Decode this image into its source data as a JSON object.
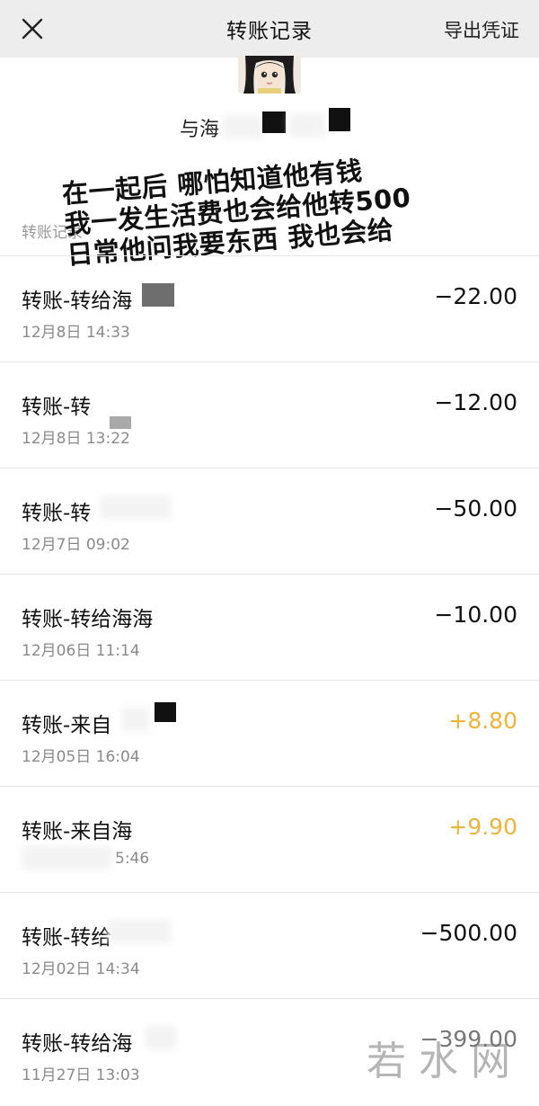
{
  "header": {
    "title": "转账记录",
    "export_label": "导出凭证"
  },
  "peer": {
    "name_visible": "与海"
  },
  "section_label": "转账记录",
  "overlay_text": [
    "在一起后 哪怕知道他有钱",
    "我一发生活费也会给他转500",
    "日常他问我要东西 我也会给"
  ],
  "transactions": [
    {
      "name": "转账-转给海",
      "time": "12月8日 14:33",
      "amount": "−22.00",
      "type": "expense"
    },
    {
      "name": "转账-转",
      "time": "12月8日 13:22",
      "amount": "−12.00",
      "type": "expense"
    },
    {
      "name": "转账-转",
      "time": "12月7日 09:02",
      "amount": "−50.00",
      "type": "expense"
    },
    {
      "name": "转账-转给海海",
      "time": "12月06日 11:14",
      "amount": "−10.00",
      "type": "expense"
    },
    {
      "name": "转账-来自",
      "time": "12月05日 16:04",
      "amount": "+8.80",
      "type": "income"
    },
    {
      "name": "转账-来自海",
      "time": "5:46",
      "amount": "+9.90",
      "type": "income"
    },
    {
      "name": "转账-转给",
      "time": "12月02日 14:34",
      "amount": "−500.00",
      "type": "expense"
    },
    {
      "name": "转账-转给海",
      "time": "11月27日 13:03",
      "amount": "−399.00",
      "type": "expense"
    }
  ],
  "watermark": "若水网",
  "colors": {
    "header_bg": "#ededed",
    "income": "#f0b43a",
    "expense": "#111111"
  },
  "icons": {
    "close": "close-icon"
  }
}
